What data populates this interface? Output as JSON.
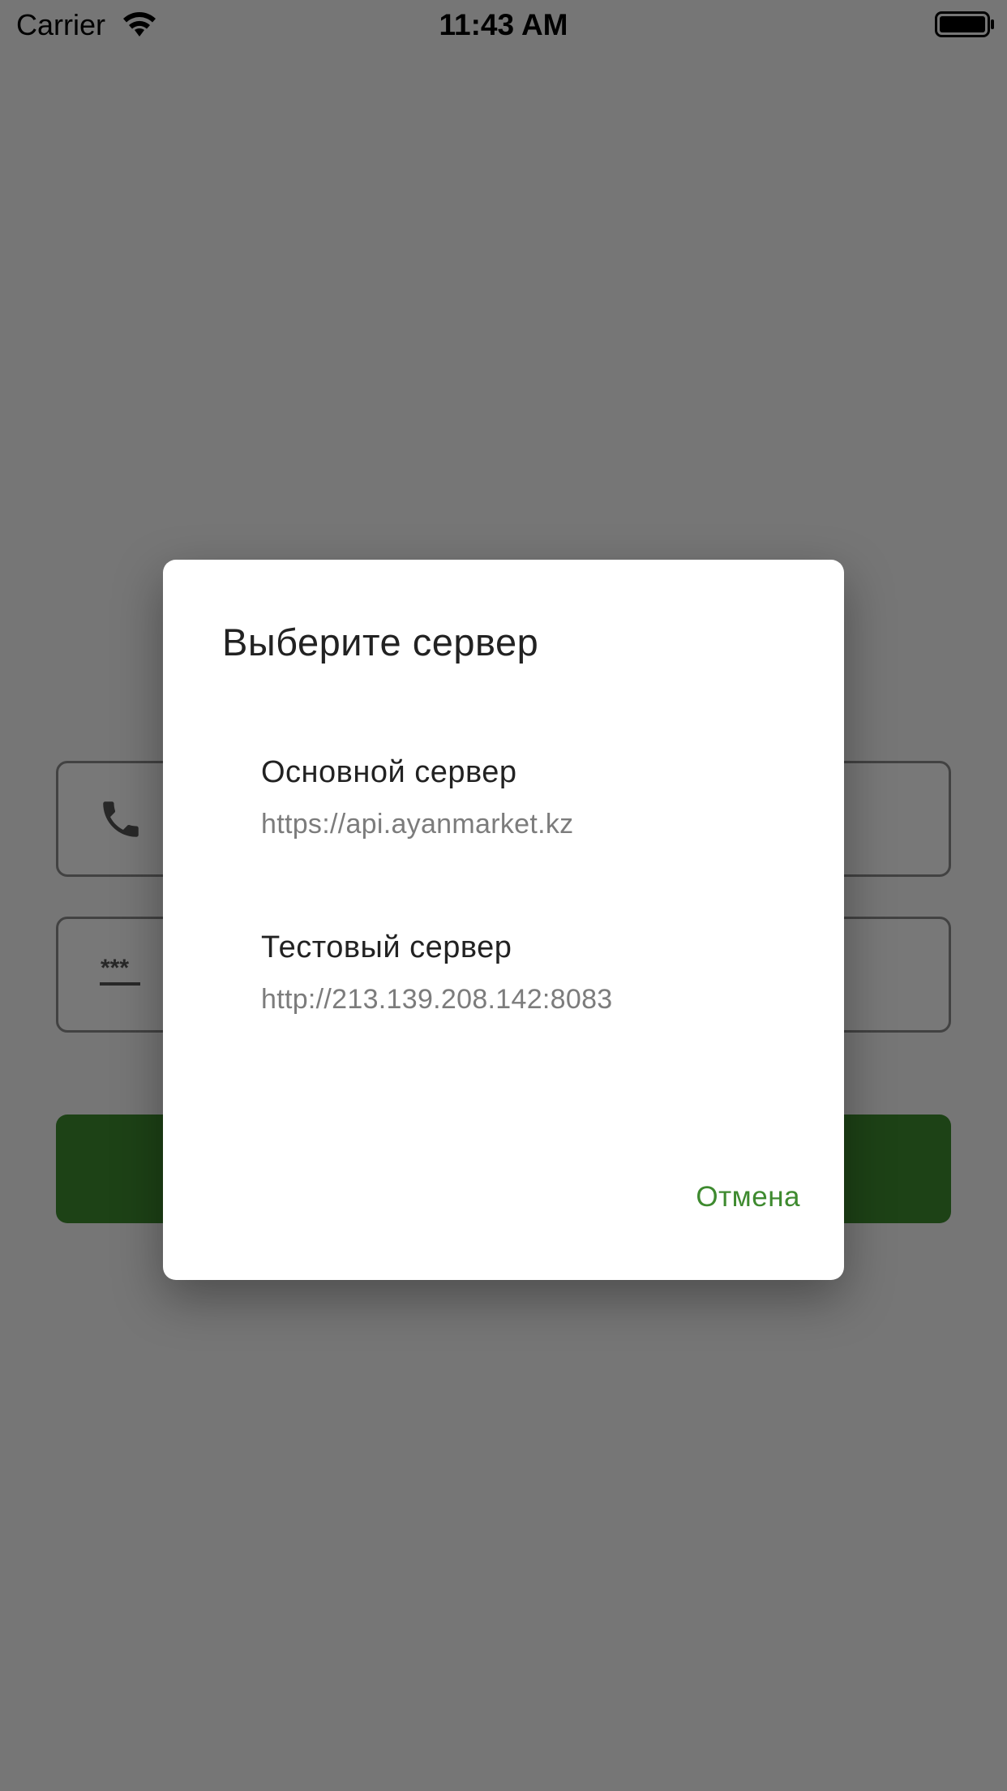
{
  "status_bar": {
    "carrier": "Carrier",
    "time": "11:43 AM",
    "icons": [
      "wifi-icon",
      "battery-icon"
    ]
  },
  "background": {
    "phone_field_icon": "phone-icon",
    "password_field_icon": "password-dots-icon",
    "login_button_color": "#3d8a2f"
  },
  "dialog": {
    "title": "Выберите сервер",
    "options": [
      {
        "name": "Основной сервер",
        "url": "https://api.ayanmarket.kz"
      },
      {
        "name": "Тестовый сервер",
        "url": "http://213.139.208.142:8083"
      }
    ],
    "cancel_label": "Отмена",
    "accent_color": "#3e8a2f"
  }
}
